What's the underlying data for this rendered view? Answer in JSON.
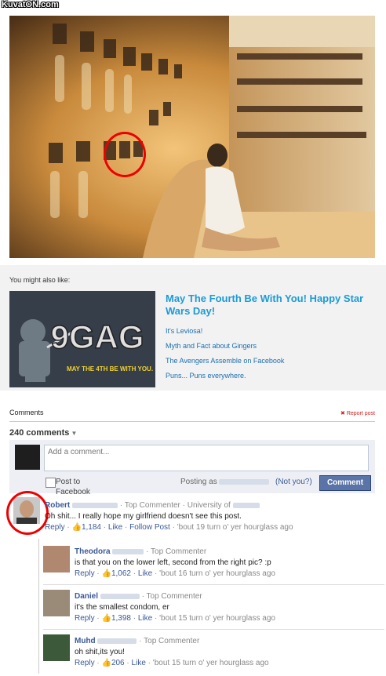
{
  "watermark": "KuvatON.com",
  "also_like": {
    "label": "You might also like:",
    "featured_title": "May The Fourth Be With You! Happy Star Wars Day!",
    "thumb_text": "9GAG",
    "thumb_caption": "MAY THE 4TH BE WITH YOU.",
    "links": [
      "It's Leviosa!",
      "Myth and Fact about Gingers",
      "The Avengers Assemble on Facebook",
      "Puns... Puns everywhere."
    ]
  },
  "comments_section": {
    "label": "Comments",
    "report": "Report post",
    "count": "240 comments",
    "input_placeholder": "Add a comment...",
    "post_to": "Post to Facebook",
    "posting_as": "Posting as",
    "not_you": "(Not you?)",
    "comment_button": "Comment"
  },
  "comments": [
    {
      "name": "Robert",
      "top": "· Top Commenter",
      "extra": "· University of",
      "text": "Oh shit... I really hope my girlfriend doesn't see this post.",
      "reply": "Reply",
      "likes": "1,184",
      "like": "Like",
      "follow": "Follow Post",
      "time": "'bout 19 turn o' yer hourglass ago"
    }
  ],
  "replies": [
    {
      "name": "Theodora",
      "top": "· Top Commenter",
      "text": "is that you on the lower left, second from the right pic? :p",
      "reply": "Reply",
      "likes": "1,062",
      "like": "Like",
      "time": "'bout 16 turn o' yer hourglass ago"
    },
    {
      "name": "Daniel",
      "top": "· Top Commenter",
      "text": "it's the smallest condom, er",
      "reply": "Reply",
      "likes": "1,398",
      "like": "Like",
      "time": "'bout 15 turn o' yer hourglass ago"
    },
    {
      "name": "Muhd",
      "top": "· Top Commenter",
      "text": "oh shit,its you!",
      "reply": "Reply",
      "likes": "206",
      "like": "Like",
      "time": "'bout 15 turn o' yer hourglass ago"
    }
  ],
  "colors": {
    "accent": "#3b5998",
    "featured": "#1a9bd7",
    "highlight": "#e00000"
  }
}
